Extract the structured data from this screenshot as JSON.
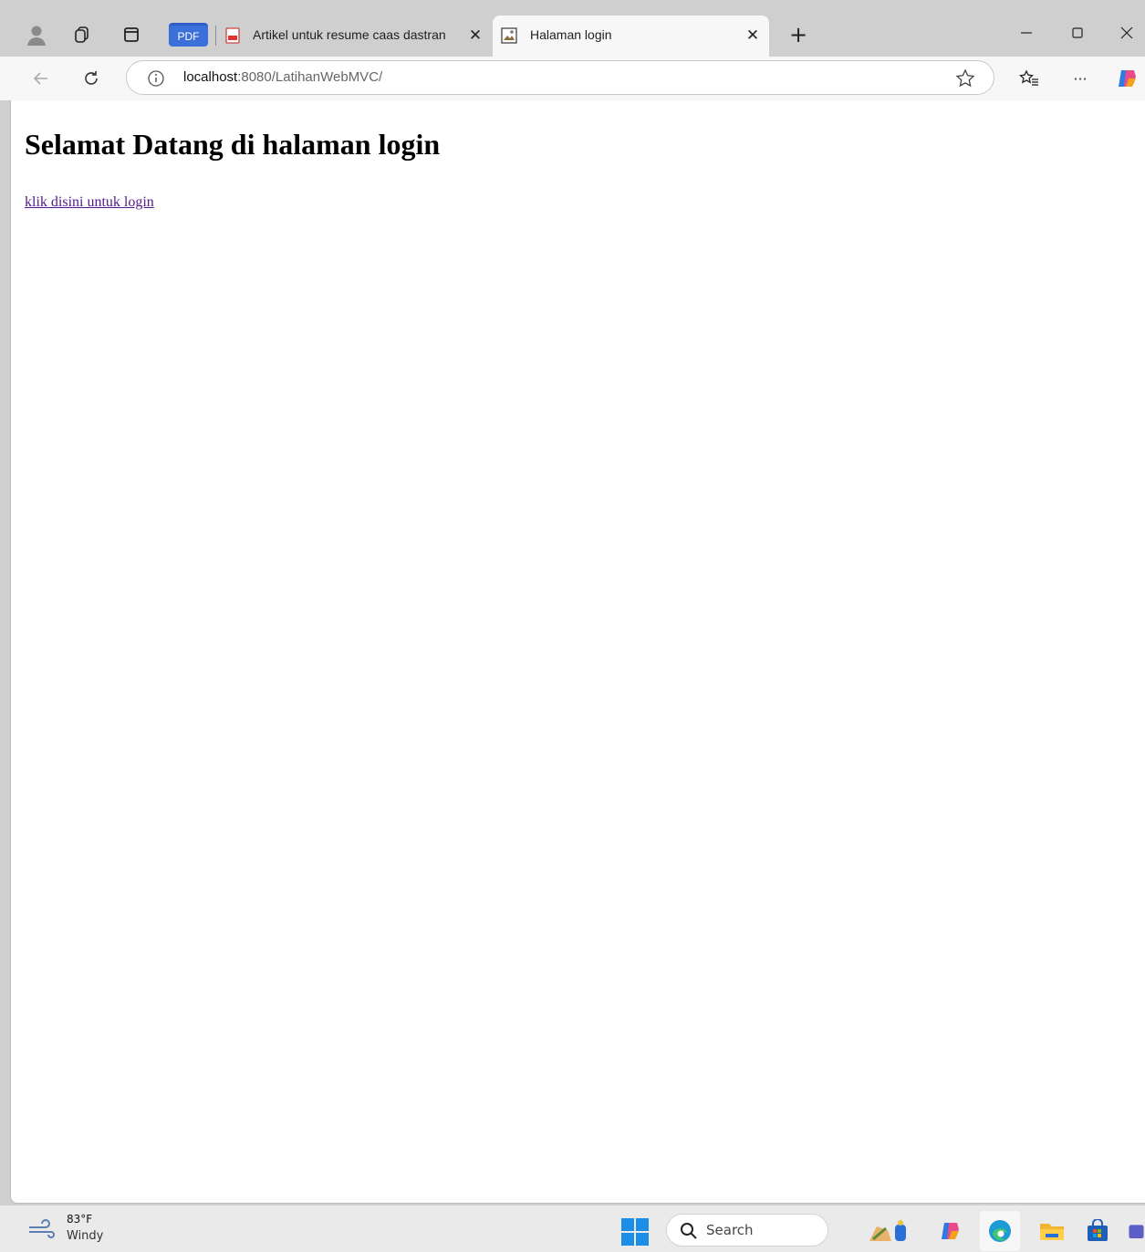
{
  "browser": {
    "pdf_badge": "PDF",
    "tabs": [
      {
        "label": "Artikel untuk resume caas dastran",
        "active": false
      },
      {
        "label": "Halaman login",
        "active": true
      }
    ],
    "url_host": "localhost",
    "url_rest": ":8080/LatihanWebMVC/"
  },
  "page": {
    "heading": "Selamat Datang di halaman login",
    "link_text": "klik disini untuk login",
    "link_color": "#551a8b"
  },
  "taskbar": {
    "weather_temp": "83°F",
    "weather_condition": "Windy",
    "search_label": "Search"
  },
  "colors": {
    "accent_blue": "#3b6fd9",
    "start_blue": "#1c8ee6"
  }
}
